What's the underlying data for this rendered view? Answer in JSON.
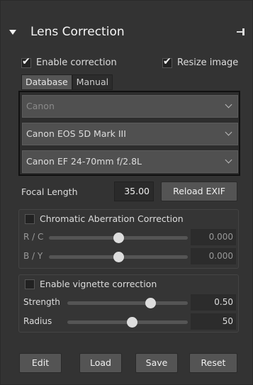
{
  "header": {
    "title": "Lens Correction"
  },
  "options": {
    "enable_correction": {
      "label": "Enable correction",
      "checked": true
    },
    "resize_image": {
      "label": "Resize image",
      "checked": true
    }
  },
  "tabs": [
    {
      "label": "Database",
      "active": true
    },
    {
      "label": "Manual",
      "active": false
    }
  ],
  "database": {
    "make": "Canon",
    "model": "Canon EOS 5D Mark III",
    "lens": "Canon EF 24-70mm f/2.8L"
  },
  "focal": {
    "label": "Focal Length",
    "value": "35.00",
    "reload_label": "Reload EXIF"
  },
  "chromatic": {
    "label": "Chromatic Aberration Correction",
    "checked": false,
    "rc": {
      "label": "R / C",
      "value": "0.000",
      "position": 0.5
    },
    "by": {
      "label": "B / Y",
      "value": "0.000",
      "position": 0.5
    }
  },
  "vignette": {
    "label": "Enable vignette correction",
    "checked": false,
    "strength": {
      "label": "Strength",
      "value": "0.50",
      "position": 0.65
    },
    "radius": {
      "label": "Radius",
      "value": "50",
      "position": 0.5
    }
  },
  "buttons": {
    "edit": "Edit",
    "load": "Load",
    "save": "Save",
    "reset": "Reset"
  }
}
